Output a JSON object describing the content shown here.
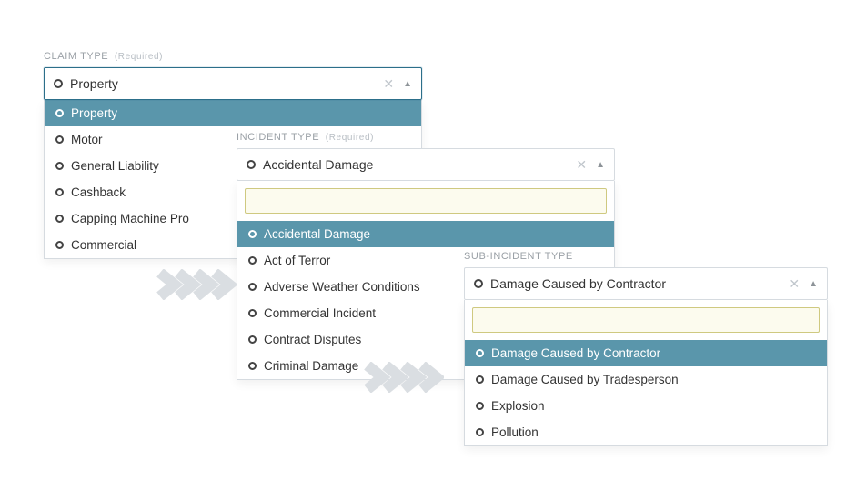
{
  "claim": {
    "label": "CLAIM TYPE",
    "required": "(Required)",
    "value": "Property",
    "options": [
      "Property",
      "Motor",
      "General Liability",
      "Cashback",
      "Capping Machine Pro",
      "Commercial"
    ],
    "selected_index": 0
  },
  "incident": {
    "label": "INCIDENT TYPE",
    "required": "(Required)",
    "value": "Accidental Damage",
    "search": "",
    "options": [
      "Accidental Damage",
      "Act of Terror",
      "Adverse Weather Conditions",
      "Commercial Incident",
      "Contract Disputes",
      "Criminal Damage"
    ],
    "selected_index": 0
  },
  "subincident": {
    "label": "SUB-INCIDENT TYPE",
    "required": "",
    "value": "Damage Caused by Contractor",
    "search": "",
    "options": [
      "Damage Caused by Contractor",
      "Damage Caused by Tradesperson",
      "Explosion",
      "Pollution"
    ],
    "selected_index": 0
  },
  "icons": {
    "clear": "✕",
    "up": "▲"
  }
}
